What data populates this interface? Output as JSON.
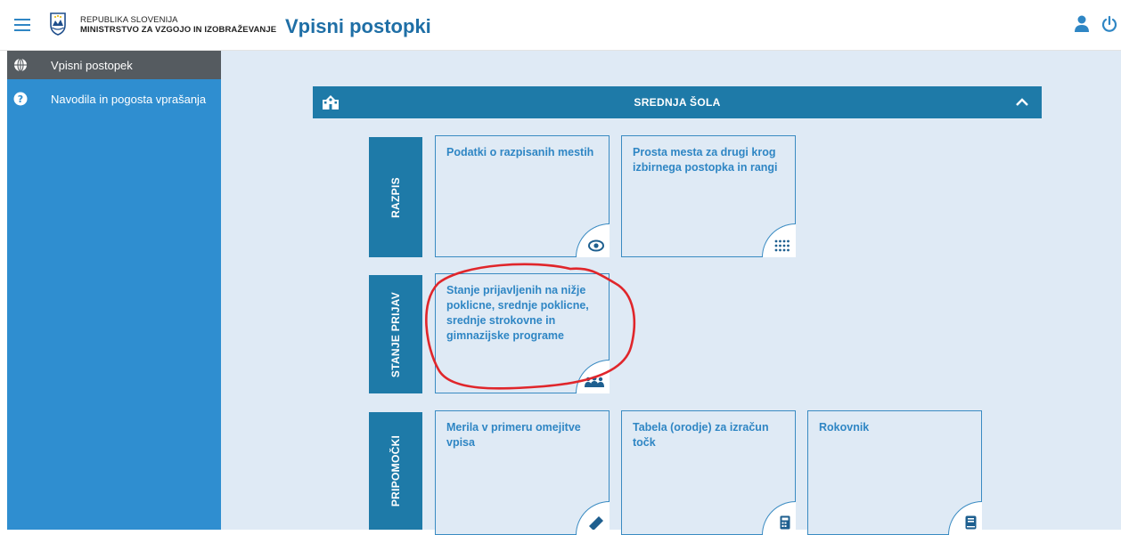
{
  "header": {
    "org_line1": "REPUBLIKA SLOVENIJA",
    "org_line2": "MINISTRSTVO ZA VZGOJO IN IZOBRAŽEVANJE",
    "app_title": "Vpisni postopki"
  },
  "sidebar": {
    "items": [
      {
        "label": "Vpisni postopek",
        "icon": "globe-icon",
        "active": true
      },
      {
        "label": "Navodila in pogosta vprašanja",
        "icon": "question-icon",
        "active": false
      }
    ]
  },
  "section": {
    "title": "SREDNJA ŠOLA",
    "expanded": true
  },
  "groups": {
    "razpis": {
      "label": "RAZPIS",
      "cards": [
        {
          "title": "Podatki o razpisanih mestih",
          "icon": "eye-icon"
        },
        {
          "title": "Prosta mesta za drugi krog izbirnega postopka in rangi",
          "icon": "grid-dots-icon"
        }
      ]
    },
    "stanje": {
      "label": "STANJE PRIJAV",
      "cards": [
        {
          "title": "Stanje prijavljenih na nižje poklicne, srednje poklicne, srednje strokovne in gimnazijske programe",
          "icon": "people-icon"
        }
      ]
    },
    "pripomocki": {
      "label": "PRIPOMOČKI",
      "cards": [
        {
          "title": "Merila v primeru omejitve vpisa",
          "icon": "ruler-icon"
        },
        {
          "title": "Tabela (orodje) za izračun točk",
          "icon": "calculator-icon"
        },
        {
          "title": "Rokovnik",
          "icon": "book-icon"
        }
      ]
    }
  },
  "colors": {
    "accent": "#1e7aa8",
    "sidebar": "#2f8ed0",
    "active_item": "#555b60",
    "background": "#dfeaf5",
    "link_text": "#2f86c4",
    "annotation": "#e0262b"
  }
}
